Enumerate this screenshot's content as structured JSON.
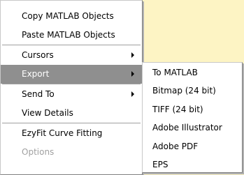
{
  "context_menu": {
    "items": [
      {
        "label": "Copy MATLAB Objects"
      },
      {
        "label": "Paste MATLAB Objects"
      },
      {
        "label": "Cursors"
      },
      {
        "label": "Export"
      },
      {
        "label": "Send To"
      },
      {
        "label": "View Details"
      },
      {
        "label": "EzyFit Curve Fitting"
      },
      {
        "label": "Options"
      }
    ]
  },
  "export_submenu": {
    "items": [
      {
        "label": "To MATLAB"
      },
      {
        "label": "Bitmap (24 bit)"
      },
      {
        "label": "TIFF (24 bit)"
      },
      {
        "label": "Adobe Illustrator"
      },
      {
        "label": "Adobe PDF"
      },
      {
        "label": "EPS"
      }
    ]
  },
  "colors": {
    "background": "#fdf4c4",
    "menu_background": "#ffffff",
    "highlight": "#8f8f8f",
    "disabled_text": "#a0a0a0"
  }
}
